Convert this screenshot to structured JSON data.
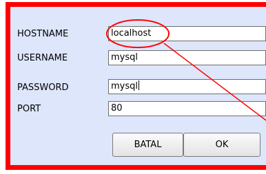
{
  "form": {
    "hostname": {
      "label": "HOSTNAME",
      "value": "localhost"
    },
    "username": {
      "label": "USERNAME",
      "value": "mysql"
    },
    "password": {
      "label": "PASSWORD",
      "value": "mysql"
    },
    "port": {
      "label": "PORT",
      "value": "80"
    }
  },
  "buttons": {
    "cancel_label": "BATAL",
    "ok_label": "OK"
  },
  "annotation": {
    "color": "#ff0000"
  }
}
